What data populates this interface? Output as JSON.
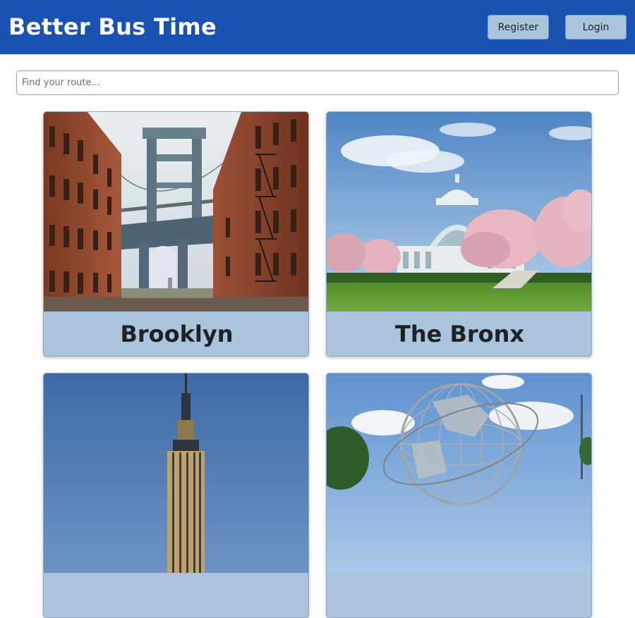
{
  "header": {
    "title": "Better Bus Time",
    "register_label": "Register",
    "login_label": "Login",
    "brand_color": "#1a52b3",
    "button_color": "#a9c4db"
  },
  "search": {
    "placeholder": "Find your route..."
  },
  "boroughs": [
    {
      "name": "Brooklyn",
      "image": "manhattan-bridge-street-photo"
    },
    {
      "name": "The Bronx",
      "image": "botanical-garden-conservatory-photo"
    },
    {
      "name": "",
      "image": "empire-state-building-photo"
    },
    {
      "name": "",
      "image": "unisphere-photo"
    }
  ]
}
